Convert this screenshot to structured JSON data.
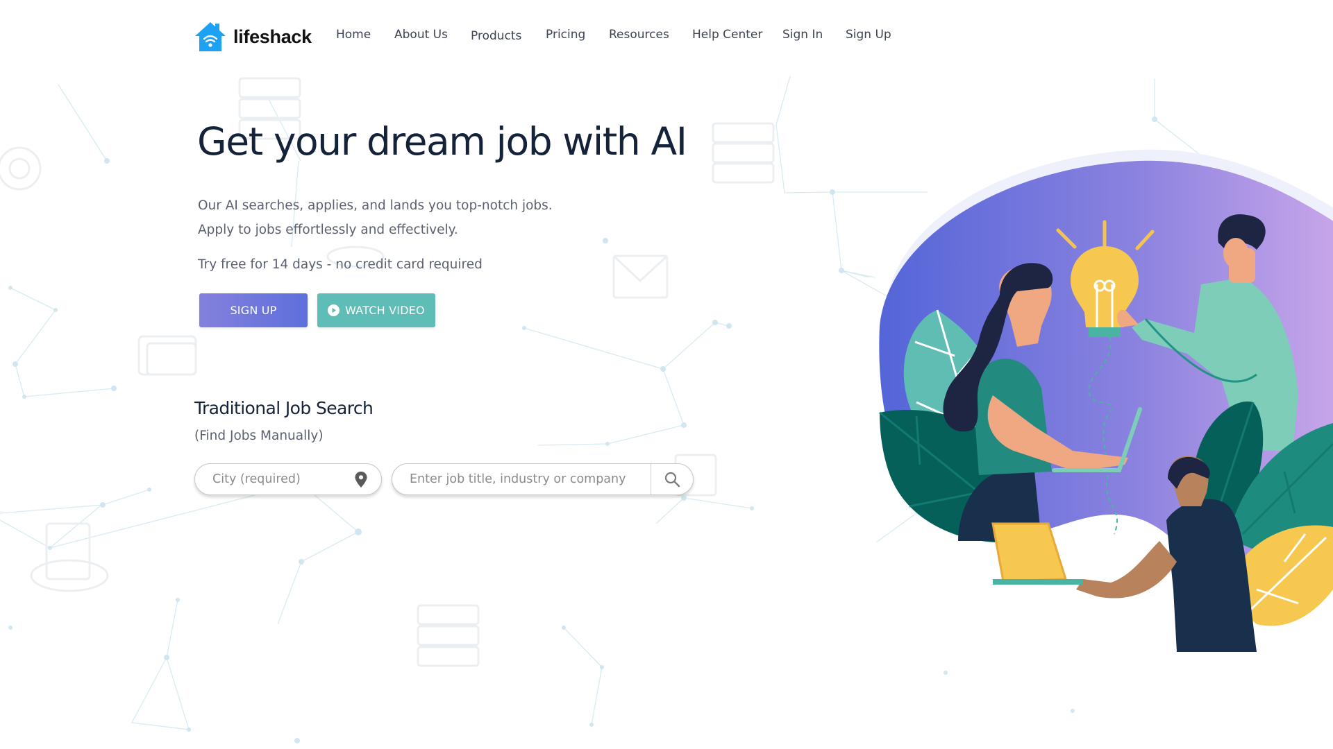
{
  "brand": {
    "name": "lifeshack",
    "logo_icon": "house-wifi-icon",
    "logo_color": "#1da1f2"
  },
  "nav": {
    "items": [
      {
        "label": "Home"
      },
      {
        "label": "About Us"
      },
      {
        "label": "Products"
      },
      {
        "label": "Pricing"
      },
      {
        "label": "Resources"
      },
      {
        "label": "Help Center"
      },
      {
        "label": "Sign In"
      },
      {
        "label": "Sign Up"
      }
    ]
  },
  "hero": {
    "headline": "Get your dream job with AI",
    "lead": "Our AI searches, applies, and lands you top-notch jobs. Apply to jobs effortlessly and effectively.",
    "trial": "Try free for 14 days - no credit card required",
    "signup_label": "SIGN UP",
    "watch_label": "WATCH VIDEO",
    "watch_icon": "play-circle-icon"
  },
  "search": {
    "title": "Traditional Job Search",
    "subtitle": "(Find Jobs Manually)",
    "city_placeholder": "City (required)",
    "city_value": "",
    "city_icon": "map-pin-icon",
    "job_placeholder": "Enter job title, industry or company",
    "job_value": "",
    "search_icon": "search-icon"
  },
  "colors": {
    "primary_gradient_start": "#8480dd",
    "primary_gradient_end": "#5e6fdc",
    "teal": "#5ebdb6",
    "heading": "#14233a",
    "body_text": "#5b6070"
  }
}
